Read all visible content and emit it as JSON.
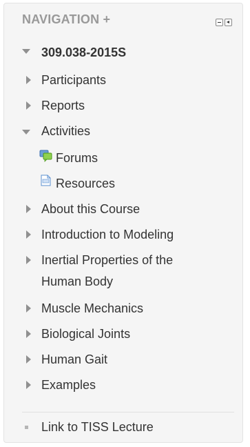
{
  "navigation": {
    "title": "NAVIGATION +",
    "course": "309.038-2015S",
    "participants": "Participants",
    "reports": "Reports",
    "activities": "Activities",
    "forums": "Forums",
    "resources": "Resources",
    "sections": [
      "About this Course",
      "Introduction to Modeling",
      "Inertial Properties of the",
      "Human Body",
      "Muscle Mechanics",
      "Biological Joints",
      "Human Gait",
      "Examples"
    ],
    "external_link": "Link to TISS Lecture"
  },
  "colors": {
    "link": "#0070a8",
    "text": "#333333",
    "header": "#999999",
    "background": "#f5f5f5"
  },
  "icons": [
    "dock-icon",
    "collapse-icon",
    "forum-icon",
    "resource-icon"
  ]
}
